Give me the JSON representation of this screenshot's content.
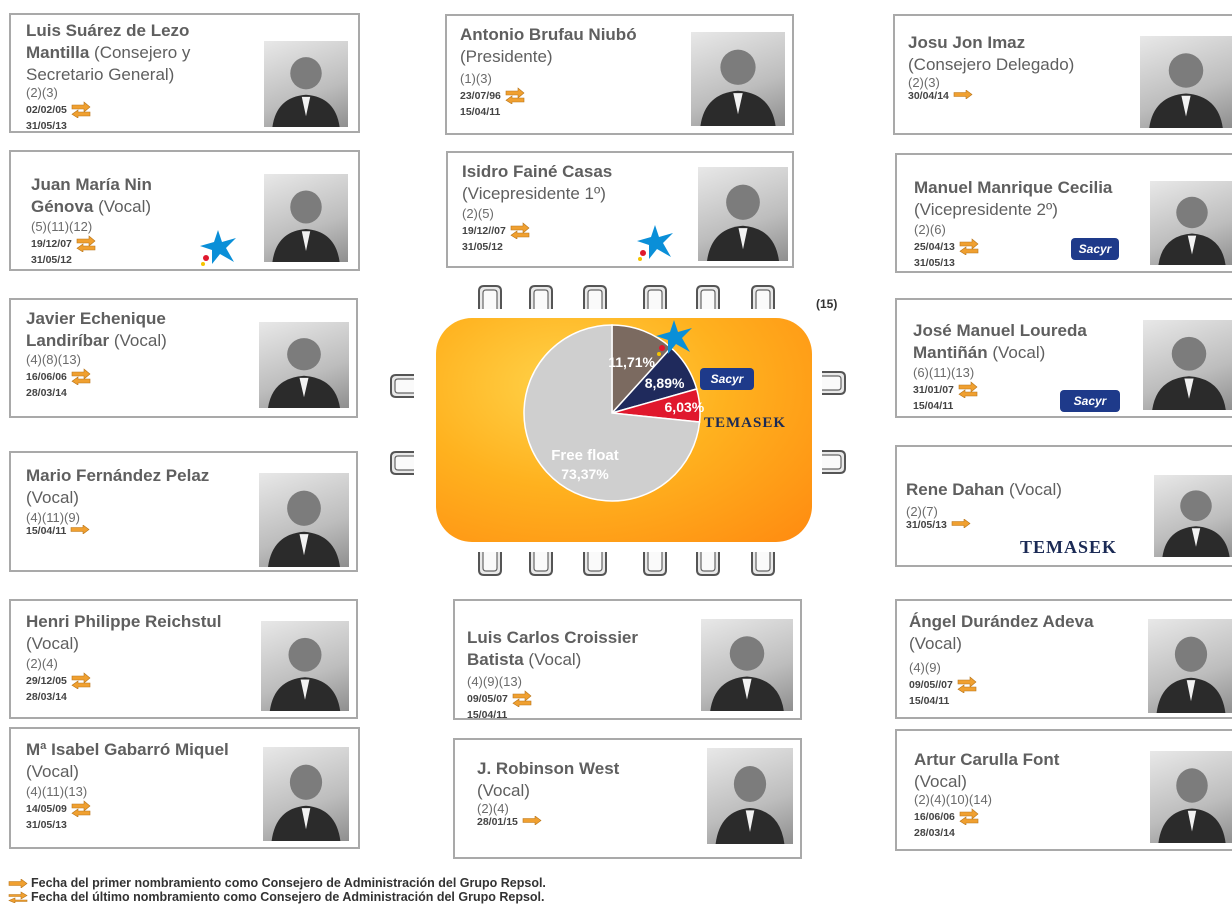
{
  "board": {
    "chair_count_note": "(15)",
    "members": [
      {
        "id": "suarez",
        "name": "Luis Suárez de Lezo Mantilla",
        "role": "(Consejero y Secretario General)",
        "codes": "(2)(3)",
        "date_first": "02/02/05",
        "date_last": "31/05/13"
      },
      {
        "id": "nin",
        "name": "Juan María Nin Génova",
        "role": "(Vocal)",
        "codes": "(5)(11)(12)",
        "date_first": "19/12/07",
        "date_last": "31/05/12",
        "logo": "caixa"
      },
      {
        "id": "echenique",
        "name": "Javier Echenique Landiríbar",
        "role": "(Vocal)",
        "codes": "(4)(8)(13)",
        "date_first": "16/06/06",
        "date_last": "28/03/14"
      },
      {
        "id": "fernandez",
        "name": "Mario Fernández Pelaz",
        "role": "(Vocal)",
        "codes": "(4)(11)(9)",
        "date_first": "15/04/11"
      },
      {
        "id": "reichstul",
        "name": "Henri Philippe Reichstul",
        "role": "(Vocal)",
        "codes": "(2)(4)",
        "date_first": "29/12/05",
        "date_last": "28/03/14"
      },
      {
        "id": "gabarro",
        "name": "Mª Isabel Gabarró Miquel",
        "role": "(Vocal)",
        "codes": "(4)(11)(13)",
        "date_first": "14/05/09",
        "date_last": "31/05/13"
      },
      {
        "id": "brufau",
        "name": "Antonio  Brufau Niubó",
        "role": "(Presidente)",
        "codes": "(1)(3)",
        "date_first": "23/07/96",
        "date_last": "15/04/11"
      },
      {
        "id": "faine",
        "name": "Isidro Fainé Casas",
        "role": "(Vicepresidente 1º)",
        "codes": "(2)(5)",
        "date_first": "19/12//07",
        "date_last": "31/05/12",
        "logo": "caixa"
      },
      {
        "id": "croissier",
        "name": "Luis Carlos Croissier Batista",
        "role": "(Vocal)",
        "codes": " (4)(9)(13)",
        "date_first": "09/05/07",
        "date_last": "15/04/11"
      },
      {
        "id": "west",
        "name": "J. Robinson West",
        "role": " (Vocal)",
        "codes": "(2)(4)",
        "date_first": "28/01/15"
      },
      {
        "id": "imaz",
        "name": "Josu Jon Imaz",
        "role": "(Consejero Delegado)",
        "codes": "(2)(3)",
        "date_first": "30/04/14"
      },
      {
        "id": "manrique",
        "name": "Manuel Manrique Cecilia",
        "role": "(Vicepresidente 2º)",
        "codes": "(2)(6)",
        "date_first": "25/04/13",
        "date_last": "31/05/13",
        "logo": "sacyr"
      },
      {
        "id": "loureda",
        "name": "José Manuel Loureda Mantiñán",
        "role": "(Vocal)",
        "codes": "(6)(11)(13)",
        "date_first": "31/01/07",
        "date_last": "15/04/11",
        "logo": "sacyr"
      },
      {
        "id": "dahan",
        "name": "Rene Dahan",
        "role": "(Vocal)",
        "codes": "(2)(7)",
        "date_first": "31/05/13",
        "logo": "temasek"
      },
      {
        "id": "durandez",
        "name": "Ángel Durández Adeva",
        "role": "(Vocal)",
        "codes": "(4)(9)",
        "date_first": "09/05//07",
        "date_last": "15/04/11"
      },
      {
        "id": "carulla",
        "name": "Artur Carulla Font",
        "role": "(Vocal)",
        "codes": "(2)(4)(10)(14)",
        "date_first": "16/06/06",
        "date_last": "28/03/14"
      }
    ]
  },
  "logos": {
    "sacyr_text": "Sacyr",
    "temasek_text": "TEMASEK"
  },
  "chart_data": {
    "type": "pie",
    "slices": [
      {
        "label": "11,71%",
        "value": 11.71,
        "color": "#7b6a60"
      },
      {
        "label": "8,89%",
        "value": 8.89,
        "color": "#1f2a5c"
      },
      {
        "label": "6,03%",
        "value": 6.03,
        "color": "#e0182d"
      },
      {
        "label": "Free float 73,37%",
        "value": 73.37,
        "color": "#cfcfcf"
      }
    ],
    "free_float_label": "Free float",
    "free_float_value": "73,37%"
  },
  "legend": {
    "first": "Fecha del primer nombramiento como  Consejero de Administración  del Grupo Repsol.",
    "last": "Fecha del último nombramiento como  Consejero de Administración  del Grupo Repsol."
  },
  "colors": {
    "arrow": "#f0a030",
    "table": "#ffa51f",
    "border": "#a9a9a9"
  }
}
